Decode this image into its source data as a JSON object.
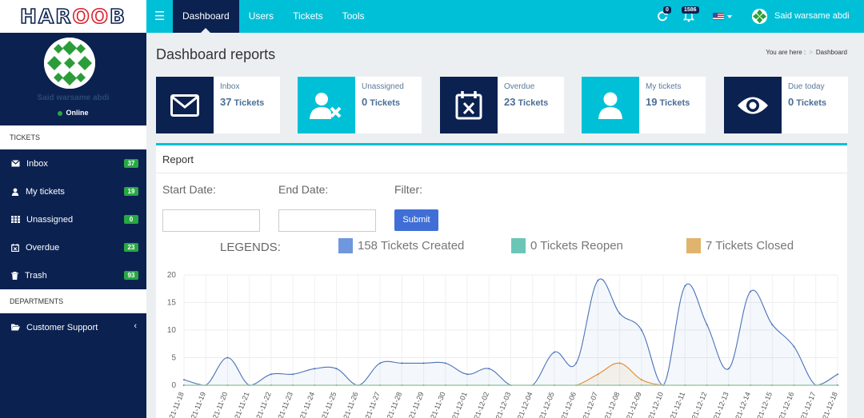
{
  "app": {
    "logo_part1": "HAR",
    "logo_part2": "OO",
    "logo_part3": "B"
  },
  "nav": [
    "Dashboard",
    "Users",
    "Tickets",
    "Tools"
  ],
  "topbar": {
    "refresh_count": "0",
    "notification_count": "1586",
    "user_name": "Said warsame abdi"
  },
  "sidebar": {
    "profile_name": "Said warsame abdi",
    "status": "Online",
    "tickets_header": "TICKETS",
    "items": [
      {
        "label": "Inbox",
        "count": "37",
        "icon": "envelope-icon"
      },
      {
        "label": "My tickets",
        "count": "19",
        "icon": "user-icon"
      },
      {
        "label": "Unassigned",
        "count": "0",
        "icon": "grid-icon"
      },
      {
        "label": "Overdue",
        "count": "23",
        "icon": "calendar-x-icon"
      },
      {
        "label": "Trash",
        "count": "93",
        "icon": "trash-icon"
      }
    ],
    "departments_header": "DEPARTMENTS",
    "departments": [
      {
        "label": "Customer Support"
      }
    ]
  },
  "page": {
    "title": "Dashboard reports",
    "breadcrumb_prefix": "You are here :",
    "breadcrumb_current": "Dashboard"
  },
  "cards": [
    {
      "label": "Inbox",
      "count": "37",
      "unit": "Tickets",
      "icon": "envelope-icon"
    },
    {
      "label": "Unassigned",
      "count": "0",
      "unit": "Tickets",
      "icon": "user-x-icon"
    },
    {
      "label": "Overdue",
      "count": "23",
      "unit": "Tickets",
      "icon": "calendar-x-icon"
    },
    {
      "label": "My tickets",
      "count": "19",
      "unit": "Tickets",
      "icon": "user-icon"
    },
    {
      "label": "Due today",
      "count": "0",
      "unit": "Tickets",
      "icon": "eye-icon"
    }
  ],
  "report": {
    "title": "Report",
    "start_label": "Start Date:",
    "end_label": "End Date:",
    "filter_label": "Filter:",
    "submit_label": "Submit",
    "legends_label": "LEGENDS:",
    "legend": [
      {
        "text": "158 Tickets Created",
        "color": "#6f97dd"
      },
      {
        "text": "0 Tickets Reopen",
        "color": "#6cc6b8"
      },
      {
        "text": "7 Tickets Closed",
        "color": "#e0b46c"
      }
    ]
  },
  "colors": {
    "navy": "#0b2150",
    "cyan": "#00c0d8",
    "created_line": "#4a72b8",
    "closed_line": "#e08a2a",
    "reopen_line": "#28a745"
  },
  "chart_data": {
    "type": "line",
    "ylim": [
      0,
      20
    ],
    "yticks": [
      0,
      5,
      10,
      15,
      20
    ],
    "categories": [
      "21-11-18",
      "21-11-19",
      "21-11-20",
      "21-11-21",
      "21-11-22",
      "21-11-23",
      "21-11-24",
      "21-11-25",
      "21-11-26",
      "21-11-27",
      "21-11-28",
      "21-11-29",
      "21-11-30",
      "21-12-01",
      "21-12-02",
      "21-12-03",
      "21-12-04",
      "21-12-05",
      "21-12-06",
      "21-12-07",
      "21-12-08",
      "21-12-09",
      "21-12-10",
      "21-12-11",
      "21-12-12",
      "21-12-13",
      "21-12-14",
      "21-12-15",
      "21-12-16",
      "21-12-17",
      "21-12-18"
    ],
    "series": [
      {
        "values": [
          1,
          0,
          5,
          0,
          2,
          2,
          3,
          3,
          0,
          4,
          4,
          4,
          4,
          2,
          3,
          0,
          0,
          6,
          4,
          19,
          13,
          10,
          0,
          18,
          11,
          3,
          17,
          11,
          7,
          0,
          2
        ]
      },
      {
        "values": [
          0,
          0,
          0,
          0,
          0,
          0,
          0,
          0,
          0,
          0,
          0,
          0,
          0,
          0,
          0,
          0,
          0,
          0,
          0,
          2,
          4,
          1,
          0,
          0,
          0,
          0,
          0,
          0,
          0,
          0,
          0
        ]
      },
      {
        "values": [
          0,
          0,
          0,
          0,
          0,
          0,
          0,
          0,
          0,
          0,
          0,
          0,
          0,
          0,
          0,
          0,
          0,
          0,
          0,
          0,
          0,
          0,
          0,
          0,
          0,
          0,
          0,
          0,
          0,
          0,
          0
        ]
      }
    ]
  }
}
